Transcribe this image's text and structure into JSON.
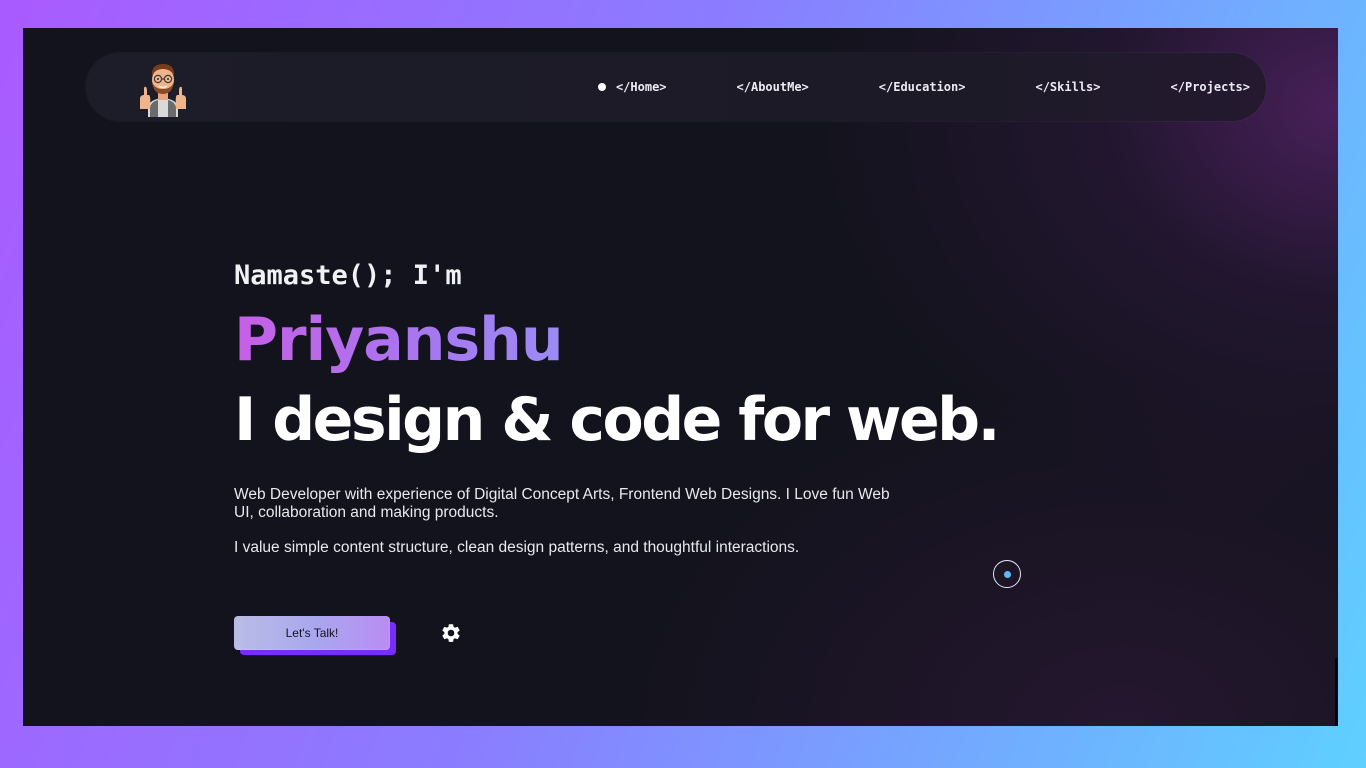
{
  "nav": {
    "avatar_icon": "memoji-thumbs-up-avatar",
    "items": [
      {
        "label": "</Home>",
        "active": true
      },
      {
        "label": "</AboutMe>",
        "active": false
      },
      {
        "label": "</Education>",
        "active": false
      },
      {
        "label": "</Skills>",
        "active": false
      },
      {
        "label": "</Projects>",
        "active": false
      }
    ]
  },
  "hero": {
    "greeting": "Namaste(); I'm",
    "name": "Priyanshu",
    "tagline": "I design & code for web.",
    "description": "Web Developer with experience of Digital Concept Arts, Frontend Web Designs. I Love fun Web UI, collaboration and making products.",
    "values": "I value simple content structure, clean design patterns, and thoughtful interactions."
  },
  "actions": {
    "talk_label": "Let's Talk!",
    "settings_icon": "gear-icon"
  },
  "colors": {
    "background": "#13131d",
    "accent_name_start": "#c75fe6",
    "accent_name_end": "#9b8cf5",
    "button_shadow": "#7a2cff",
    "cursor_dot": "#5fb8ff"
  }
}
